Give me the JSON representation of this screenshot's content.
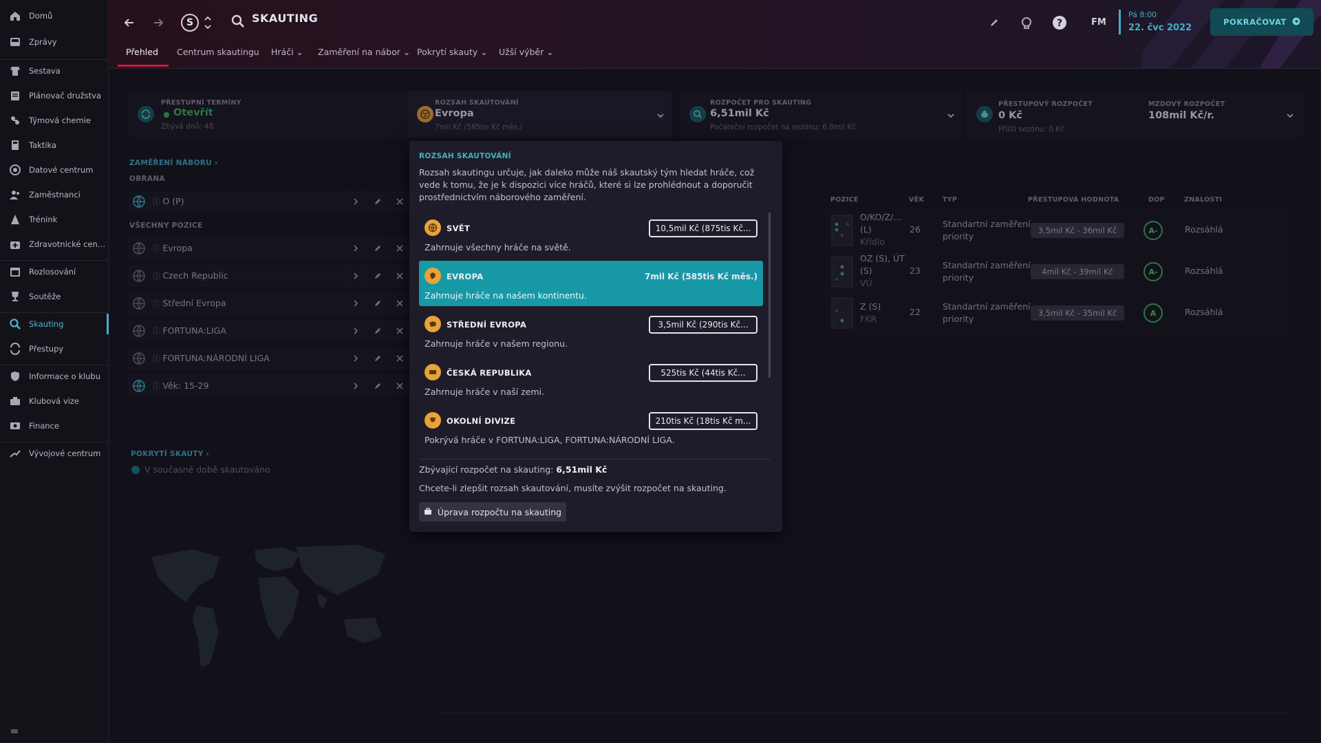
{
  "sidebar": {
    "items": [
      {
        "label": "Domů",
        "icon": "home-icon"
      },
      {
        "label": "Zprávy",
        "icon": "inbox-icon"
      },
      {
        "label": "Sestava",
        "icon": "squad-icon"
      },
      {
        "label": "Plánovač družstva",
        "icon": "planner-icon"
      },
      {
        "label": "Týmová chemie",
        "icon": "chemistry-icon"
      },
      {
        "label": "Taktika",
        "icon": "tactics-icon"
      },
      {
        "label": "Datové centrum",
        "icon": "data-hub-icon"
      },
      {
        "label": "Zaměstnanci",
        "icon": "staff-icon"
      },
      {
        "label": "Trénink",
        "icon": "training-icon"
      },
      {
        "label": "Zdravotnické centr...",
        "icon": "medical-icon"
      },
      {
        "label": "Rozlosování",
        "icon": "schedule-icon"
      },
      {
        "label": "Soutěže",
        "icon": "trophy-icon"
      },
      {
        "label": "Skauting",
        "icon": "search-icon"
      },
      {
        "label": "Přestupy",
        "icon": "transfers-icon"
      },
      {
        "label": "Informace o klubu",
        "icon": "shield-icon"
      },
      {
        "label": "Klubová vize",
        "icon": "vision-icon"
      },
      {
        "label": "Finance",
        "icon": "finance-icon"
      },
      {
        "label": "Vývojové centrum",
        "icon": "development-icon"
      }
    ]
  },
  "header": {
    "club_badge": "S",
    "title": "SKAUTING",
    "tabs": [
      "Přehled",
      "Centrum skautingu",
      "Hráči",
      "Zaměření na nábor",
      "Pokrytí skauty",
      "Užší výběr"
    ],
    "fm_label": "FM",
    "time": "Pá 8:00",
    "date": "22. čvc 2022",
    "continue_label": "POKRAČOVAT"
  },
  "info_bar": {
    "transfer_window": {
      "label": "PŘESTUPNÍ TERMÍNY",
      "value": "Otevřít",
      "sub": "Zbývá dnů: 48"
    },
    "scouting_range": {
      "label": "ROZSAH SKAUTOVÁNÍ",
      "value": "Evropa",
      "sub": "7mil Kč (585tis Kč měs.)"
    },
    "scouting_budget": {
      "label": "ROZPOČET PRO SKAUTING",
      "value": "6,51mil Kč",
      "sub": "Počáteční rozpočet na sezónu: 6,8mil Kč"
    },
    "transfer_budget": {
      "label": "PŘESTUPOVÝ ROZPOČET",
      "value": "0 Kč",
      "sub": "Příští sezónu: 0 Kč"
    },
    "wage_budget": {
      "label": "MZDOVÝ ROZPOČET",
      "value": "108mil Kč/r."
    }
  },
  "recruitment": {
    "link": "ZAMĚŘENÍ NÁBORU ›",
    "defence_head": "OBRANA",
    "defence_items": [
      "O (P)"
    ],
    "all_head": "VŠECHNY POZICE",
    "all_items": [
      "Evropa",
      "Czech Republic",
      "Střední Evropa",
      "FORTUNA:LIGA",
      "FORTUNA:NÁRODNÍ LIGA",
      "Věk: 15-29"
    ],
    "coverage_link": "POKRYTÍ SKAUTY ›",
    "coverage_status": "V současné době skautováno"
  },
  "players_table": {
    "headers": [
      "POZICE",
      "VĚK",
      "TYP",
      "PŘESTUPOVÁ HODNOTA",
      "DOP",
      "ZNALOSTI"
    ],
    "rows": [
      {
        "pos": "O/KO/Z/...",
        "pos2": "(L)",
        "role": "Křídlo",
        "age": "26",
        "type1": "Standartní zaměření",
        "type2": "priority",
        "value": "3,5mil Kč - 36mil Kč",
        "rec": "A-",
        "knowledge": "Rozsáhlá"
      },
      {
        "pos": "OZ (S), ÚT",
        "pos2": "(S)",
        "role": "VÚ",
        "age": "23",
        "type1": "Standartní zaměření",
        "type2": "priority",
        "value": "4mil Kč - 39mil Kč",
        "rec": "A-",
        "knowledge": "Rozsáhlá"
      },
      {
        "pos": "Z (S)",
        "pos2": "",
        "role": "FKR",
        "age": "22",
        "type1": "Standartní zaměření",
        "type2": "priority",
        "value": "3,5mil Kč - 35mil Kč",
        "rec": "A",
        "knowledge": "Rozsáhlá"
      }
    ]
  },
  "popup": {
    "title": "ROZSAH SKAUTOVÁNÍ",
    "description": "Rozsah skautingu určuje, jak daleko může náš skautský tým hledat hráče, což vede k tomu, že je k dispozici více hráčů, které si lze prohlédnout a doporučit prostřednictvím náborového zaměření.",
    "options": [
      {
        "name": "SVĚT",
        "price": "10,5mil Kč (875tis Kč...",
        "desc": "Zahrnuje všechny hráče na světě.",
        "selected": false
      },
      {
        "name": "EVROPA",
        "price": "7mil Kč (585tis Kč měs.)",
        "desc": "Zahrnuje hráče na našem kontinentu.",
        "selected": true
      },
      {
        "name": "STŘEDNÍ EVROPA",
        "price": "3,5mil Kč (290tis Kč...",
        "desc": "Zahrnuje hráče v našem regionu.",
        "selected": false
      },
      {
        "name": "ČESKÁ REPUBLIKA",
        "price": "525tis Kč (44tis Kč...",
        "desc": "Zahrnuje hráče v naší zemi.",
        "selected": false
      },
      {
        "name": "OKOLNÍ DIVIZE",
        "price": "210tis Kč (18tis Kč m...",
        "desc": "Pokrývá hráče v FORTUNA:LIGA, FORTUNA:NÁRODNÍ LIGA.",
        "selected": false
      }
    ],
    "remaining_label": "Zbývající rozpočet na skauting:",
    "remaining_value": "6,51mil Kč",
    "note": "Chcete-li zlepšit rozsah skautování, musíte zvýšit rozpočet na skauting.",
    "button_label": "Úprava rozpočtu na skauting"
  },
  "colors": {
    "accent": "#3fb3c6",
    "brand_red": "#c91f3e",
    "selected": "#1798a6",
    "option_icon": "#e8a23a",
    "grade_green": "#3cb35c"
  }
}
